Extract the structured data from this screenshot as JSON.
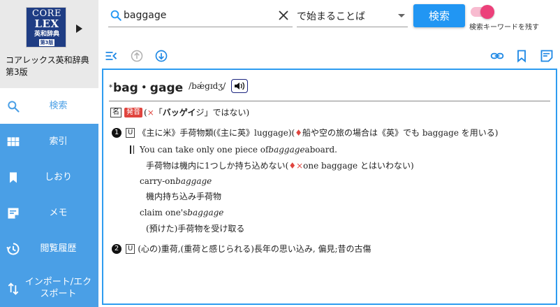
{
  "book": {
    "cover": {
      "line1": "CORE",
      "line2": "LEX",
      "line3": "英和辞典",
      "edition": "第3版"
    },
    "title": "コアレックス英和辞典第3版"
  },
  "nav": {
    "items": [
      {
        "label": "検索",
        "icon": "search-icon",
        "active": true
      },
      {
        "label": "索引",
        "icon": "grid-icon"
      },
      {
        "label": "しおり",
        "icon": "bookmark-icon"
      },
      {
        "label": "メモ",
        "icon": "memo-icon"
      },
      {
        "label": "閲覧履歴",
        "icon": "history-icon"
      },
      {
        "label": "インポート/エクスポート",
        "icon": "import-export-icon"
      }
    ]
  },
  "search": {
    "query": "baggage",
    "mode": "で始まることば",
    "button": "検索",
    "keep_keyword_label": "検索キーワードを残す",
    "keep_keyword_on": true
  },
  "colors": {
    "accent": "#2196f3",
    "sidebar": "#4a9fe6",
    "toggle": "#ec407a",
    "badge": "#e0443e"
  },
  "entry": {
    "star": "*",
    "headword": "bag・gage",
    "pronunciation": "/bǽgɪdʒ/",
    "pos": "名",
    "pron_badge": "発音",
    "pron_note_open": "(",
    "pron_note_x": "×",
    "pron_note_quote_open": "「",
    "pron_note_word": "バッゲイ",
    "pron_note_rest": "ジ」ではない)",
    "senses": [
      {
        "num": "1",
        "label": "U",
        "def_main": "《主に米》手荷物類(《主に英》luggage)(",
        "def_diamond": "♦",
        "def_rest": "船や空の旅の場合は《英》でも baggage を用いる)"
      },
      {
        "num": "2",
        "label": "U",
        "def_main": "(心の)重荷,(重荷と感じられる)長年の思い込み, 偏見;昔の古傷"
      }
    ],
    "examples": [
      {
        "en_pre": "You can take only one piece of ",
        "en_em": "baggage",
        "en_post": " aboard."
      }
    ],
    "example_ja_pre": "手荷物は機内に1つしか持ち込めない(",
    "example_ja_diamond": "♦",
    "example_ja_x": "×",
    "example_ja_post": " one baggage とはいわない)",
    "phrases": [
      {
        "pre": "carry-on ",
        "em": "baggage",
        "ja": "機内持ち込み手荷物"
      },
      {
        "pre": "claim one's ",
        "em": "baggage",
        "ja": "(預けた)手荷物を受け取る"
      }
    ]
  }
}
